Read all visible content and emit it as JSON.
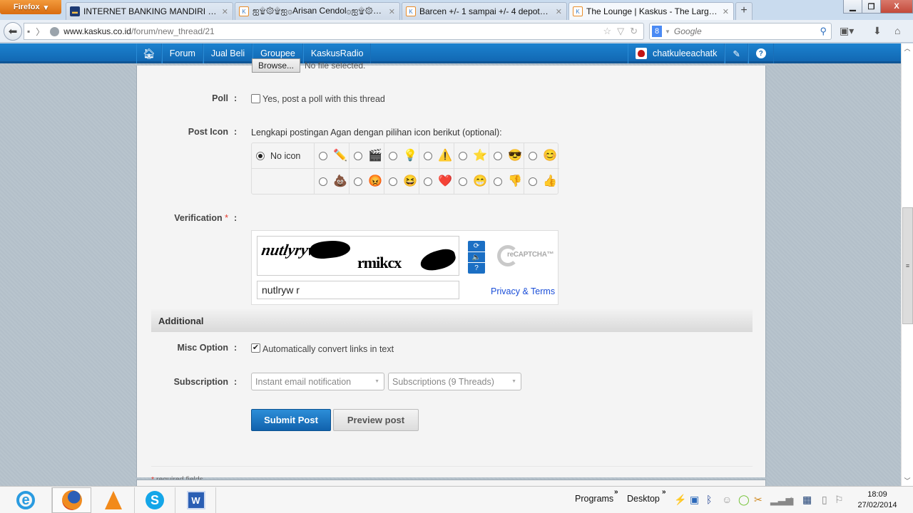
{
  "browser": {
    "app_button": "Firefox",
    "tabs": [
      {
        "label": "INTERNET BANKING MANDIRI - Welc...",
        "active": false
      },
      {
        "label": "ஐ۩۞۩ஐ۞Arisan Cendol۞ஐ۩۞۩...",
        "active": false
      },
      {
        "label": "Barcen +/- 1 sampai +/- 4 depotbata ...",
        "active": false
      },
      {
        "label": "The Lounge | Kaskus - The Largest In...",
        "active": true
      }
    ],
    "new_tab": "+",
    "url_domain": "www.kaskus.co.id",
    "url_path": "/forum/new_thread/21",
    "search_placeholder": "Google",
    "window_controls": {
      "minimize": "▁",
      "restore": "❐",
      "close": "X"
    }
  },
  "site_nav": {
    "items": [
      "Forum",
      "Jual Beli",
      "Groupee",
      "KaskusRadio"
    ],
    "username": "chatkuleeachatk"
  },
  "form": {
    "browse_label": "Browse...",
    "no_file_text": "No file selected.",
    "poll": {
      "label": "Poll",
      "checkbox_label": "Yes, post a poll with this thread",
      "checked": false
    },
    "post_icon": {
      "label": "Post Icon",
      "hint": "Lengkapi postingan Agan dengan pilihan icon berikut (optional):",
      "no_icon_label": "No icon",
      "selected": "no-icon",
      "row1": [
        {
          "name": "pencil",
          "glyph": "✏️"
        },
        {
          "name": "clapperboard",
          "glyph": "🎬"
        },
        {
          "name": "lightbulb",
          "glyph": "💡"
        },
        {
          "name": "warning",
          "glyph": "⚠️"
        },
        {
          "name": "star",
          "glyph": "⭐"
        },
        {
          "name": "sunglasses-face",
          "glyph": "😎"
        },
        {
          "name": "smile-face",
          "glyph": "😊"
        }
      ],
      "row2": [
        {
          "name": "poop",
          "glyph": "💩"
        },
        {
          "name": "angry-face",
          "glyph": "😡"
        },
        {
          "name": "laughing-face",
          "glyph": "😆"
        },
        {
          "name": "heart",
          "glyph": "❤️"
        },
        {
          "name": "grin-face",
          "glyph": "😁"
        },
        {
          "name": "thumbs-down",
          "glyph": "👎"
        },
        {
          "name": "thumbs-up",
          "glyph": "👍"
        }
      ]
    },
    "verification": {
      "label": "Verification",
      "required_mark": "*",
      "captcha_word1": "nutlyryw",
      "captcha_word2": "rmikcx",
      "input_value": "nutlryw r",
      "logo_text": "reCAPTCHA™",
      "privacy_link": "Privacy & Terms",
      "buttons": [
        "⟳",
        "🔈",
        "?"
      ]
    },
    "additional_header": "Additional",
    "misc_option": {
      "label": "Misc Option",
      "checkbox_label": "Automatically convert links in text",
      "checked": true
    },
    "subscription": {
      "label": "Subscription",
      "notification_select": "Instant email notification",
      "folder_select": "Subscriptions (9 Threads)"
    },
    "submit_label": "Submit Post",
    "preview_label": "Preview post",
    "colon": ":",
    "required_note": "required fields"
  },
  "taskbar": {
    "programs_label": "Programs",
    "desktop_label": "Desktop",
    "chevron": "»",
    "time": "18:09",
    "date": "27/02/2014"
  },
  "colors": {
    "site_nav_blue": "#1268b3",
    "submit_blue": "#1a78c7",
    "required_red": "#e4392b",
    "link_blue": "#1a4ed8"
  }
}
